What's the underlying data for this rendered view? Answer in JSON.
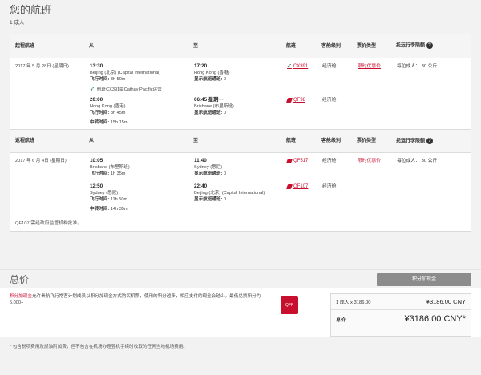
{
  "header": {
    "title": "您的航班",
    "passengers": "1 成人"
  },
  "outbound": {
    "columns": [
      "起程航班",
      "从",
      "至",
      "航班",
      "客舱级别",
      "票价类型",
      "托运行李限额"
    ],
    "date": "2017 年 5 月 28日 (星期日)",
    "legs": [
      {
        "dep_time": "13:30",
        "dep_airport": "Beijing (北京) (Capital International)",
        "duration_label": "飞行时间:",
        "duration": "3h 50m",
        "arr_time": "17:20",
        "arr_airport": "Hong Kong (香港)",
        "stops_label": "显示航班通班:",
        "stops": "0",
        "flight": "CX391",
        "cabin": "经济舱",
        "fare": "限时优惠价",
        "baggage": "每位成人： 30 公斤",
        "operator": "航班CX391由Cathay Pacific运营"
      },
      {
        "dep_time": "20:00",
        "dep_airport": "Hong Kong (香港)",
        "duration_label": "飞行时间:",
        "duration": "8h 45m",
        "layover_label": "中转时间:",
        "layover": "15h 15m",
        "arr_time": "06:45 星期一",
        "arr_airport": "Brisbane (布里斯班)",
        "stops_label": "显示航班通班:",
        "stops": "0",
        "flight": "QF98",
        "cabin": "经济舱"
      }
    ]
  },
  "inbound": {
    "columns": [
      "返程航班",
      "从",
      "至",
      "航班",
      "客舱级别",
      "票价类型",
      "托运行李限额"
    ],
    "date": "2017 年 6 月 4日 (星期日)",
    "legs": [
      {
        "dep_time": "10:05",
        "dep_airport": "Brisbane (布里斯班)",
        "duration_label": "飞行时间:",
        "duration": "1h 35m",
        "arr_time": "11:40",
        "arr_airport": "Sydney (悉尼)",
        "stops_label": "显示航班通班:",
        "stops": "0",
        "flight": "QF517",
        "cabin": "经济舱",
        "fare": "限时优惠价",
        "baggage": "每位成人： 30 公斤"
      },
      {
        "dep_time": "12:50",
        "dep_airport": "Sydney (悉尼)",
        "duration_label": "飞行时间:",
        "duration": "11h 50m",
        "layover_label": "中转时间:",
        "layover": "14h 35m",
        "arr_time": "22:40",
        "arr_airport": "Beijing (北京) (Capital International)",
        "stops_label": "显示航班通班:",
        "stops": "0",
        "flight": "QF107",
        "cabin": "经济舱"
      }
    ],
    "note": "QF107 需经政府监管机构批准。"
  },
  "total": {
    "title": "总价",
    "button": "积分加现金",
    "promo_link": "积分加现金",
    "promo_text": "允许贵航飞行常客计划成员以积分加现金方式购买机票，使用的积分越多，相应支付的现金会越少。最低兑换积分为 5,000+",
    "logo_text": "QFF",
    "row1_label": "1 成人 x 3186.00",
    "row1_amount": "¥3186.00 CNY",
    "row2_label": "总价",
    "row2_amount": "¥3186.00 CNY*"
  },
  "footer": {
    "note": "* 包含税项费用及燃油附加费，但不包含在机场办理登机手续时收取的任何当地机场费用。"
  },
  "colors": {
    "accent_red": "#c8102e",
    "cathay_green": "#00645a",
    "button_gray": "#8c8c8c"
  }
}
